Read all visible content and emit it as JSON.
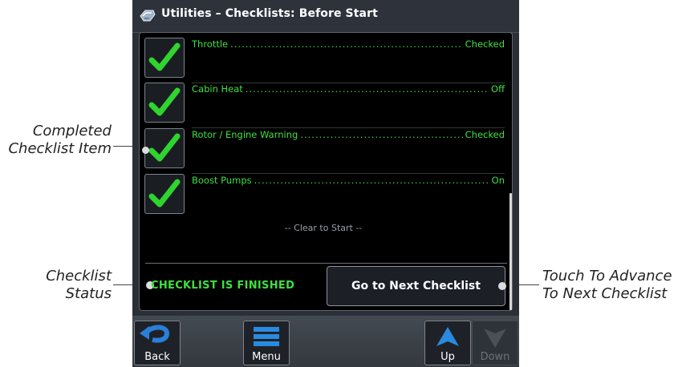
{
  "window": {
    "title": "Utilities – Checklists: Before Start"
  },
  "checklist": {
    "items": [
      {
        "name": "Throttle",
        "value": "Checked"
      },
      {
        "name": "Cabin Heat",
        "value": "Off"
      },
      {
        "name": "Rotor / Engine Warning",
        "value": "Checked"
      },
      {
        "name": "Boost Pumps",
        "value": "On"
      }
    ],
    "footer_note": "-- Clear to Start --",
    "status": "CHECKLIST IS FINISHED",
    "next_button": "Go to Next Checklist"
  },
  "bottom_bar": {
    "back": "Back",
    "menu": "Menu",
    "up": "Up",
    "down": "Down"
  },
  "callouts": {
    "completed_item": [
      "Completed",
      "Checklist Item"
    ],
    "status": [
      "Checklist",
      "Status"
    ],
    "advance": [
      "Touch To Advance",
      "To Next Checklist"
    ]
  },
  "colors": {
    "accent": "#3ee03e",
    "background": "#000000",
    "frame": "#2b3038"
  },
  "icons": {
    "title": "checklist-icon",
    "check": "checkmark-icon",
    "back": "back-arrow-icon",
    "menu": "menu-icon",
    "up": "up-arrow-icon",
    "down": "down-arrow-icon"
  }
}
